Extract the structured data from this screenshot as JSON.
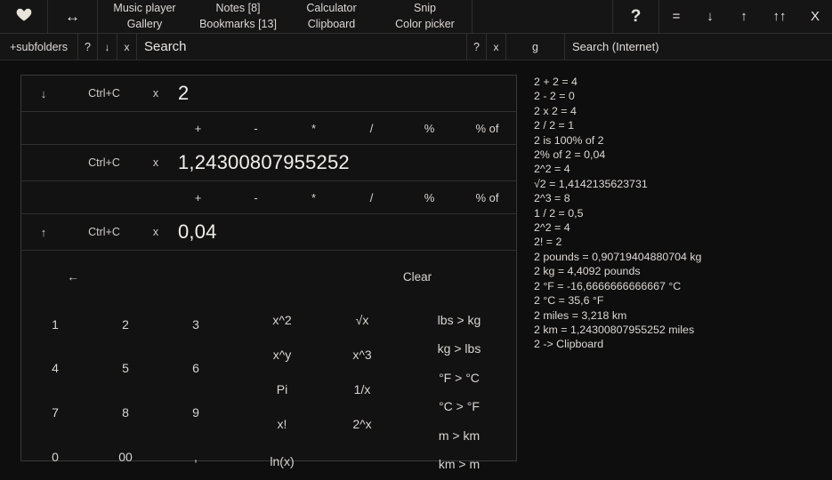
{
  "topbar": {
    "heart_icon": "heart-icon",
    "resize_icon": "resize-horizontal-icon",
    "menu": [
      {
        "top": "Music player",
        "bottom": "Gallery"
      },
      {
        "top": "Notes [8]",
        "bottom": "Bookmarks [13]"
      },
      {
        "top": "Calculator",
        "bottom": "Clipboard"
      },
      {
        "top": "Snip",
        "bottom": "Color picker"
      }
    ],
    "help_label": "?",
    "controls": [
      {
        "name": "equals-button",
        "label": "="
      },
      {
        "name": "minimize-button",
        "label": "↓"
      },
      {
        "name": "restore-button",
        "label": "↑"
      },
      {
        "name": "maximize-button",
        "label": "↑↑"
      },
      {
        "name": "close-button",
        "label": "X"
      }
    ]
  },
  "searchbar": {
    "subfolders_label": "+subfolders",
    "help_label": "?",
    "down_label": "↓",
    "clear_label": "x",
    "search_value": "Search",
    "help2_label": "?",
    "clear2_label": "x",
    "google_label": "g",
    "internet_value": "Search (Internet)"
  },
  "calculator": {
    "row1": {
      "arrow": "↓",
      "copy": "Ctrl+C",
      "x": "x",
      "value": "2"
    },
    "row2": {
      "arrow": "",
      "copy": "Ctrl+C",
      "x": "x",
      "value": "1,24300807955252"
    },
    "row3": {
      "arrow": "↑",
      "copy": "Ctrl+C",
      "x": "x",
      "value": "0,04"
    },
    "operators": [
      "+",
      "-",
      "*",
      "/",
      "%",
      "% of"
    ],
    "backspace_label": "←",
    "clear_label": "Clear",
    "digits": [
      [
        "1",
        "2",
        "3"
      ],
      [
        "4",
        "5",
        "6"
      ],
      [
        "7",
        "8",
        "9"
      ],
      [
        "0",
        "00",
        ","
      ]
    ],
    "func_col1": [
      "x^2",
      "x^y",
      "Pi",
      "x!",
      "ln(x)"
    ],
    "func_col2": [
      "√x",
      "x^3",
      "1/x",
      "2^x"
    ],
    "conversions": [
      "lbs > kg",
      "kg > lbs",
      "°F > °C",
      "°C > °F",
      "m > km",
      "km > m"
    ]
  },
  "results": [
    "2 + 2 = 4",
    "2 - 2 = 0",
    "2 x 2 = 4",
    "2 / 2 = 1",
    "2 is 100% of 2",
    "2% of 2 = 0,04",
    "2^2 = 4",
    "√2 = 1,4142135623731",
    "2^3 = 8",
    "1 / 2 = 0,5",
    "2^2 = 4",
    "2! = 2",
    "2 pounds = 0,90719404880704 kg",
    "2 kg = 4,4092 pounds",
    "2 °F = -16,6666666666667 °C",
    "2 °C = 35,6 °F",
    "2 miles = 3,218 km",
    "2 km = 1,24300807955252 miles",
    "2 -> Clipboard"
  ],
  "colors": {
    "page_bg": "#0e0e0e",
    "bar_bg": "#151515",
    "panel_bg": "#121212",
    "panel_border": "#3a3a3a",
    "text": "#ddd9d3"
  }
}
